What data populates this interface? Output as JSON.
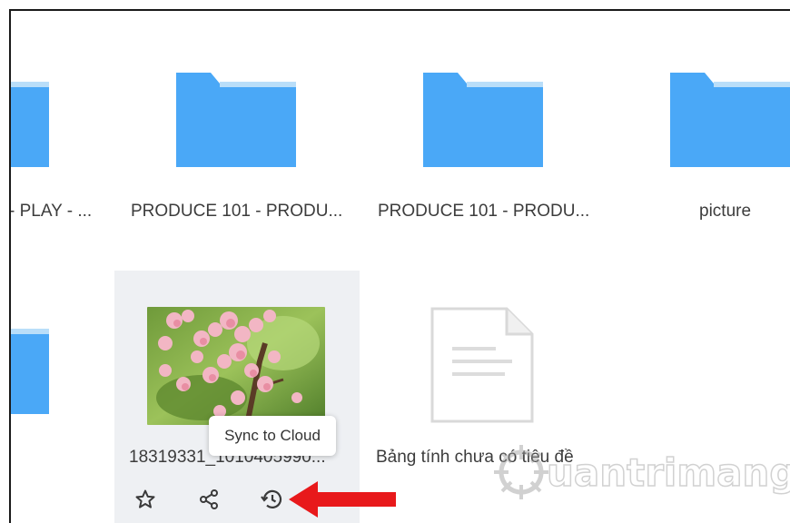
{
  "grid": {
    "row1": [
      {
        "label": "- PLAY - ...",
        "type": "folder"
      },
      {
        "label": "PRODUCE 101 - PRODU...",
        "type": "folder"
      },
      {
        "label": "PRODUCE 101 - PRODU...",
        "type": "folder"
      },
      {
        "label": "picture",
        "type": "folder"
      }
    ],
    "row2": [
      {
        "label": "",
        "type": "folder"
      },
      {
        "label": "18319331_1010405990...",
        "type": "image"
      },
      {
        "label": "Bảng tính chưa có tiêu đề",
        "type": "document"
      }
    ]
  },
  "card_actions": {
    "star": "star-icon",
    "share": "share-icon",
    "sync": "sync-cloud-icon"
  },
  "tooltip": {
    "text": "Sync to Cloud"
  },
  "watermark": {
    "text": "uantrimang"
  },
  "colors": {
    "folder": "#4aa8f7",
    "folder_tab": "#b9def9",
    "arrow": "#e8191b",
    "card_hover_bg": "#eef0f3"
  }
}
